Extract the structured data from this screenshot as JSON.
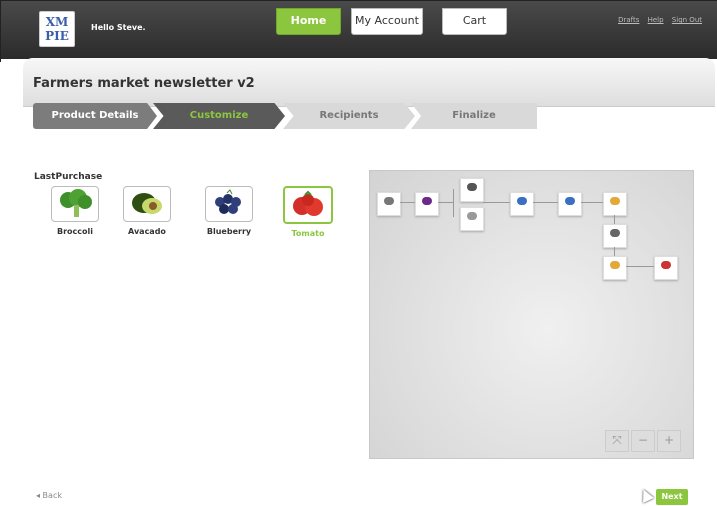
{
  "header": {
    "logo_top": "XM",
    "logo_bottom": "PIE",
    "greeting": "Hello Steve.",
    "tabs": [
      {
        "label": "Home"
      },
      {
        "label": "My Account"
      },
      {
        "label": "Cart"
      }
    ],
    "links": [
      {
        "label": "Drafts"
      },
      {
        "label": "Help"
      },
      {
        "label": "Sign Out"
      }
    ]
  },
  "page": {
    "title": "Farmers market newsletter v2",
    "steps": [
      {
        "label": "Product Details"
      },
      {
        "label": "Customize"
      },
      {
        "label": "Recipients"
      },
      {
        "label": "Finalize"
      }
    ]
  },
  "customize": {
    "section_label": "LastPurchase",
    "products": [
      {
        "label": "Broccoli",
        "icon": "broccoli-icon",
        "color": "#3f8f2a"
      },
      {
        "label": "Avacado",
        "icon": "avocado-icon",
        "color": "#4f7a1f"
      },
      {
        "label": "Blueberry",
        "icon": "blueberry-icon",
        "color": "#2e3f7a"
      },
      {
        "label": "Tomato",
        "icon": "tomato-icon",
        "color": "#d4302a",
        "selected": true
      }
    ]
  },
  "footer": {
    "back_label": "◂ Back",
    "next_label": "Next"
  },
  "colors": {
    "accent": "#8cc63f",
    "header_bg": "#3a3a3a"
  }
}
